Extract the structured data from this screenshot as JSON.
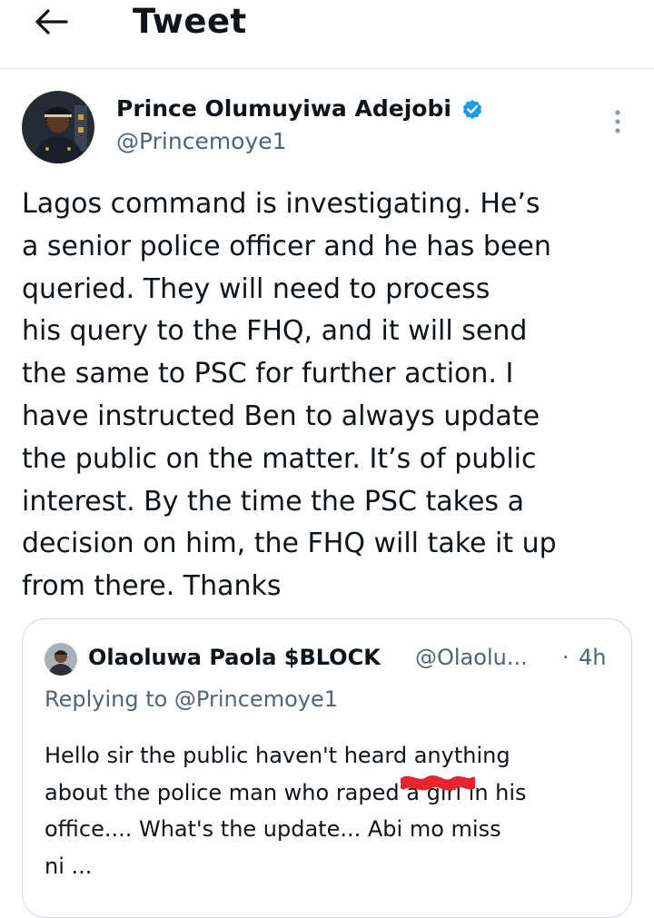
{
  "header": {
    "title": "Tweet",
    "back_icon": "arrow-left-icon"
  },
  "tweet": {
    "author": {
      "name": "Prince Olumuyiwa Adejobi",
      "handle": "@Princemoye1",
      "verified": true,
      "verified_color": "#1d9bf0"
    },
    "more_icon": "vertical-ellipsis-icon",
    "text": "Lagos command is investigating. He’s\na senior police officer and he has been\nqueried. They will need to process\nhis query to the FHQ, and it will send\nthe same to PSC for further action. I\nhave instructed Ben to always update\nthe public on the matter. It’s of public\ninterest. By the time the PSC takes a\ndecision on him, the FHQ will take it up\nfrom there. Thanks"
  },
  "quoted": {
    "name": "Olaoluwa Paola $BLOCK",
    "handle": "@Olaolu...",
    "separator": "·",
    "time": "4h",
    "replying_to": "Replying to @Princemoye1",
    "text": "Hello sir the public haven't heard anything\nabout the police man who raped a girl in his\noffice.... What's the update... Abi mo miss\nni ..."
  },
  "colors": {
    "text": "#0f1419",
    "secondary_text": "#536471",
    "border": "#cfd9de",
    "divider": "#e6e9ec",
    "redaction": "#e8252c"
  }
}
